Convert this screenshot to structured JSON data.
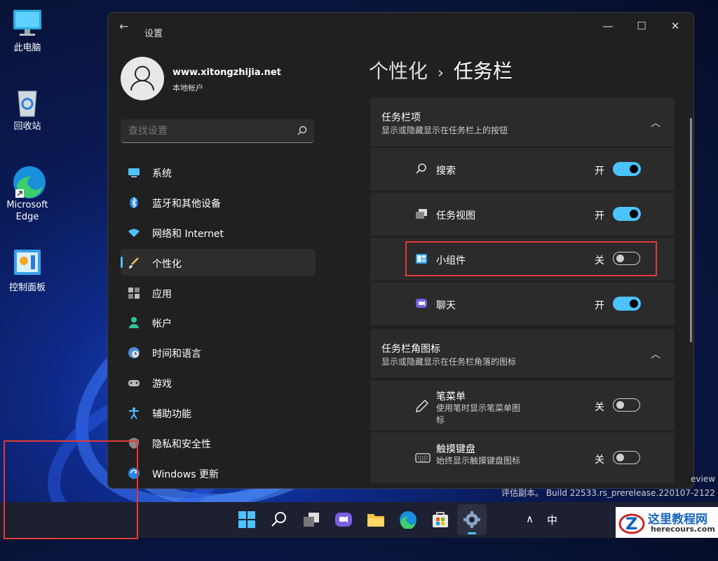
{
  "desktop": {
    "icons": [
      {
        "label": "此电脑"
      },
      {
        "label": "回收站"
      },
      {
        "label": "Microsoft Edge"
      },
      {
        "label": "控制面板"
      }
    ]
  },
  "window": {
    "title": "设置",
    "controls": {
      "minimize": "—",
      "maximize": "☐",
      "close": "✕"
    }
  },
  "account": {
    "name": "www.xitongzhijia.net",
    "type": "本地帐户"
  },
  "search": {
    "placeholder": "查找设置"
  },
  "sidebar": {
    "items": [
      {
        "label": "系统",
        "icon": "display-icon"
      },
      {
        "label": "蓝牙和其他设备",
        "icon": "bluetooth-icon"
      },
      {
        "label": "网络和 Internet",
        "icon": "wifi-icon"
      },
      {
        "label": "个性化",
        "icon": "brush-icon",
        "active": true
      },
      {
        "label": "应用",
        "icon": "apps-icon"
      },
      {
        "label": "帐户",
        "icon": "person-icon"
      },
      {
        "label": "时间和语言",
        "icon": "globe-clock-icon"
      },
      {
        "label": "游戏",
        "icon": "gamepad-icon"
      },
      {
        "label": "辅助功能",
        "icon": "accessibility-icon"
      },
      {
        "label": "隐私和安全性",
        "icon": "shield-icon"
      },
      {
        "label": "Windows 更新",
        "icon": "update-icon"
      }
    ]
  },
  "breadcrumb": {
    "parent": "个性化",
    "separator": "›",
    "current": "任务栏"
  },
  "sections": [
    {
      "title": "任务栏项",
      "subtitle": "显示或隐藏显示在任务栏上的按钮",
      "items": [
        {
          "label": "搜索",
          "state": "开",
          "on": true,
          "icon": "search-icon"
        },
        {
          "label": "任务视图",
          "state": "开",
          "on": true,
          "icon": "task-view-icon"
        },
        {
          "label": "小组件",
          "state": "关",
          "on": false,
          "icon": "widgets-icon"
        },
        {
          "label": "聊天",
          "state": "开",
          "on": true,
          "icon": "chat-icon"
        }
      ]
    },
    {
      "title": "任务栏角图标",
      "subtitle": "显示或隐藏显示在任务栏角落的图标",
      "items": [
        {
          "label": "笔菜单",
          "desc": "使用笔时显示笔菜单图标",
          "state": "关",
          "on": false,
          "icon": "pen-icon"
        },
        {
          "label": "触摸键盘",
          "desc": "始终显示触摸键盘图标",
          "state": "关",
          "on": false,
          "icon": "keyboard-icon"
        }
      ]
    }
  ],
  "watermark": {
    "line1": "eview",
    "line2": "评估副本。 Build 22533.rs_prerelease.220107-2122"
  },
  "taskbar": {
    "tray_chevron": "∧",
    "ime": "中"
  },
  "site_logo": {
    "name": "这里教程网",
    "url": "herecours.com"
  },
  "colors": {
    "accent": "#4cc2ff",
    "highlight": "#e53935"
  }
}
